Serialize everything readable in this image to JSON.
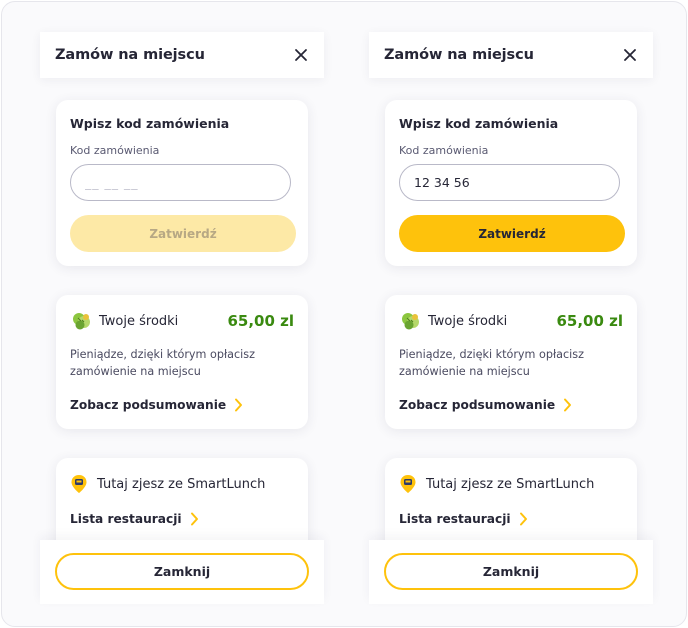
{
  "panels": [
    {
      "header": {
        "title": "Zamów na miejscu"
      },
      "code_card": {
        "title": "Wpisz kod zamówienia",
        "field_label": "Kod zamówienia",
        "input_value": "",
        "input_placeholder": "__ __ __",
        "submit_label": "Zatwierdź",
        "submit_state": "disabled"
      },
      "funds_card": {
        "label": "Twoje środki",
        "amount": "65,00 zl",
        "description": "Pieniądze, dzięki którym opłacisz zamówienie na miejscu",
        "link": "Zobacz podsumowanie"
      },
      "restaurants_card": {
        "label": "Tutaj zjesz ze SmartLunch",
        "link": "Lista restauracji"
      },
      "footer": {
        "close_label": "Zamknij"
      }
    },
    {
      "header": {
        "title": "Zamów na miejscu"
      },
      "code_card": {
        "title": "Wpisz kod zamówienia",
        "field_label": "Kod zamówienia",
        "input_value": "12 34 56",
        "input_placeholder": "__ __ __",
        "submit_label": "Zatwierdź",
        "submit_state": "active"
      },
      "funds_card": {
        "label": "Twoje środki",
        "amount": "65,00 zl",
        "description": "Pieniądze, dzięki którym opłacisz zamówienie na miejscu",
        "link": "Zobacz podsumowanie"
      },
      "restaurants_card": {
        "label": "Tutaj zjesz ze SmartLunch",
        "link": "Lista restauracji"
      },
      "footer": {
        "close_label": "Zamknij"
      }
    }
  ],
  "icons": {
    "close": "close-icon",
    "funds": "money-icon",
    "restaurants": "location-pin-icon",
    "link_arrow": "chevron-right-icon"
  },
  "colors": {
    "accent": "#fec20c",
    "accent_disabled": "#fde9a6",
    "amount_green": "#3a8a10"
  }
}
